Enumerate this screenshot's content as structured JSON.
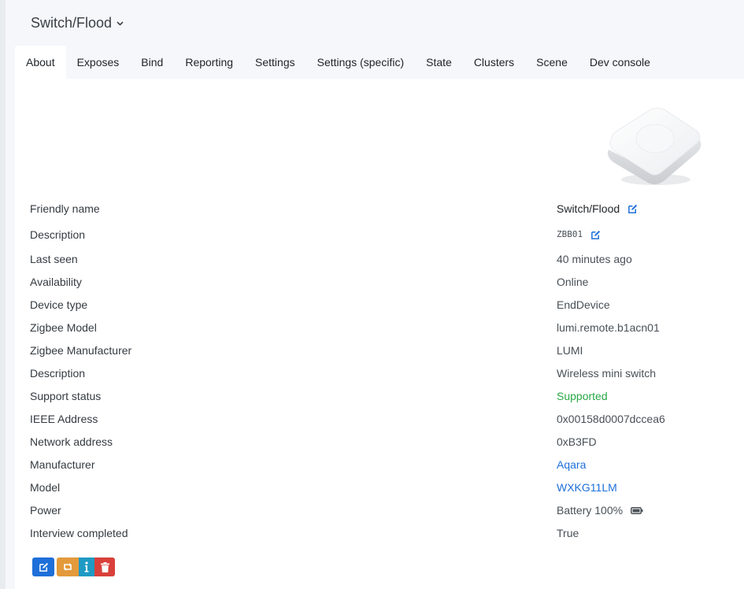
{
  "header": {
    "device_title": "Switch/Flood"
  },
  "tabs": [
    {
      "label": "About",
      "active": true
    },
    {
      "label": "Exposes"
    },
    {
      "label": "Bind"
    },
    {
      "label": "Reporting"
    },
    {
      "label": "Settings"
    },
    {
      "label": "Settings (specific)"
    },
    {
      "label": "State"
    },
    {
      "label": "Clusters"
    },
    {
      "label": "Scene"
    },
    {
      "label": "Dev console"
    }
  ],
  "info": {
    "friendly_name": {
      "label": "Friendly name",
      "value": "Switch/Flood"
    },
    "description": {
      "label": "Description",
      "value": "ZBB01"
    },
    "last_seen": {
      "label": "Last seen",
      "value": "40 minutes ago"
    },
    "availability": {
      "label": "Availability",
      "value": "Online"
    },
    "device_type": {
      "label": "Device type",
      "value": "EndDevice"
    },
    "zigbee_model": {
      "label": "Zigbee Model",
      "value": "lumi.remote.b1acn01"
    },
    "zigbee_manufacturer": {
      "label": "Zigbee Manufacturer",
      "value": "LUMI"
    },
    "description2": {
      "label": "Description",
      "value": "Wireless mini switch"
    },
    "support_status": {
      "label": "Support status",
      "value": "Supported"
    },
    "ieee_address": {
      "label": "IEEE Address",
      "value": "0x00158d0007dccea6"
    },
    "network_address": {
      "label": "Network address",
      "value": "0xB3FD"
    },
    "manufacturer": {
      "label": "Manufacturer",
      "value": "Aqara"
    },
    "model": {
      "label": "Model",
      "value": "WXKG11LM"
    },
    "power": {
      "label": "Power",
      "value": "Battery 100%",
      "battery_level": 1.0
    },
    "interview_completed": {
      "label": "Interview completed",
      "value": "True"
    }
  },
  "colors": {
    "primary": "#1e6fd9",
    "success": "#28a745",
    "warning": "#e39a3a",
    "info": "#1f9ac4",
    "danger": "#d9403a"
  },
  "actions": [
    {
      "icon": "edit-icon"
    },
    {
      "icon": "reconfigure-icon"
    },
    {
      "icon": "info-icon"
    },
    {
      "icon": "trash-icon"
    }
  ]
}
